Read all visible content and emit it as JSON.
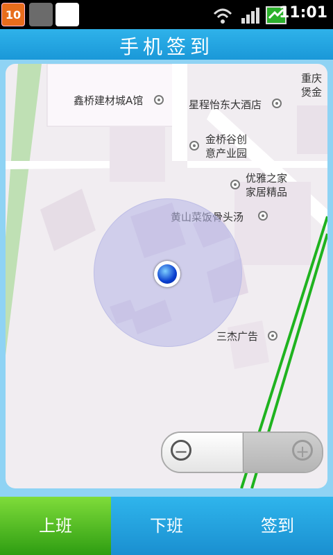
{
  "status_bar": {
    "notification_count": "10",
    "time": "11:01",
    "icons": [
      "android-icon",
      "sd-card-icon",
      "wifi-icon",
      "signal-icon",
      "battery-icon"
    ]
  },
  "header": {
    "title": "手机签到"
  },
  "map": {
    "labels": {
      "xinqiao": "鑫桥建材城A馆",
      "xingcheng": "星程怡东大酒店",
      "chongqing1": "重庆",
      "chongqing2": "煲金",
      "jinqiao1": "金桥谷创",
      "jinqiao2": "意产业园",
      "youya1": "优雅之家",
      "youya2": "家居精品",
      "huangshan": "黄山菜饭骨头汤",
      "sanjie": "三杰广告"
    }
  },
  "tabs": [
    {
      "label": "上班",
      "active": true
    },
    {
      "label": "下班",
      "active": false
    },
    {
      "label": "签到",
      "active": false
    }
  ],
  "colors": {
    "accent": "#1a98d8",
    "active_tab": "#4bbd1f",
    "route": "#1fb31f"
  }
}
